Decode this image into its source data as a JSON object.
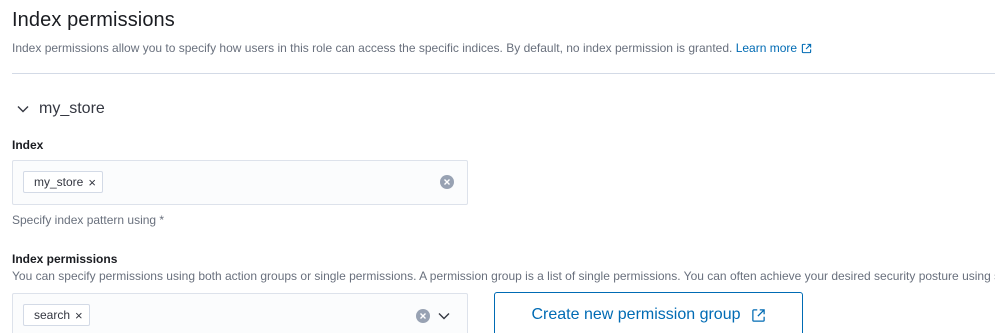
{
  "section": {
    "title": "Index permissions",
    "description": "Index permissions allow you to specify how users in this role can access the specific indices. By default, no index permission is granted.",
    "learn_more": "Learn more"
  },
  "accordion": {
    "label": "my_store",
    "icon": "chevron-down-icon"
  },
  "index_field": {
    "label": "Index",
    "selected": [
      "my_store"
    ],
    "help": "Specify index pattern using *"
  },
  "permissions_field": {
    "label": "Index permissions",
    "help": "You can specify permissions using both action groups or single permissions. A permission group is a list of single permissions. You can often achieve your desired security posture using some combination of the default permission groups. You can also create your own reusable permission groups.",
    "selected": [
      "search"
    ]
  },
  "create_button": {
    "label": "Create new permission group",
    "icon": "external-link-icon"
  },
  "colors": {
    "link": "#006bb4",
    "text": "#343741",
    "muted": "#69707d",
    "border": "#dde2eb"
  }
}
